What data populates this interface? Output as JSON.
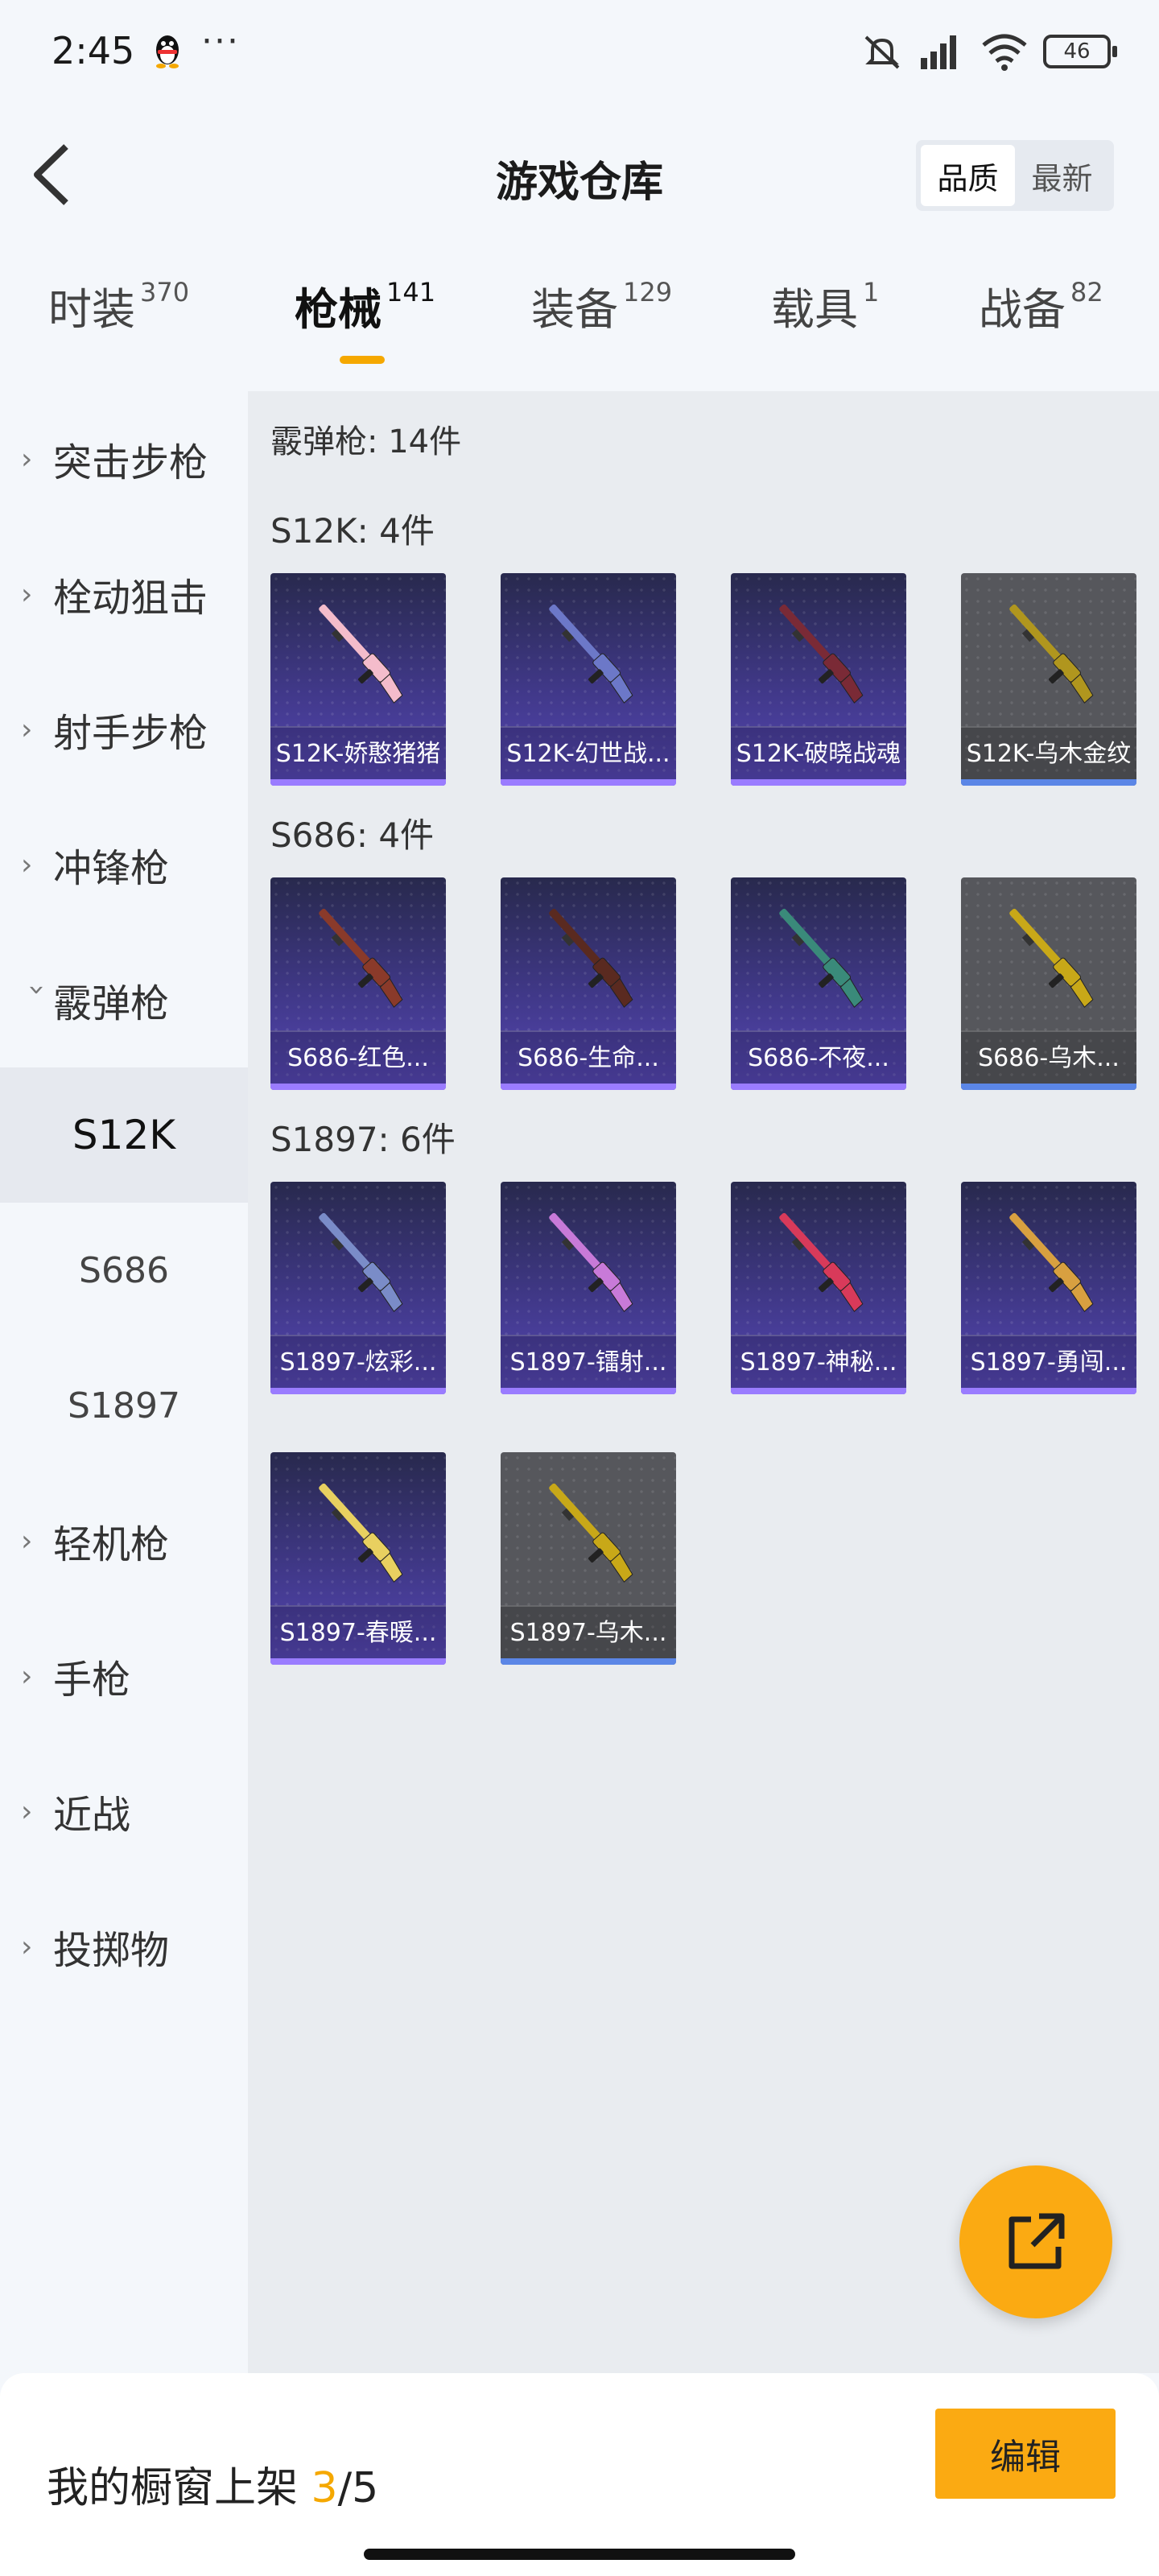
{
  "status_bar": {
    "time": "2:45",
    "dots": "···",
    "battery": "46"
  },
  "header": {
    "title": "游戏仓库",
    "sort": [
      "品质",
      "最新"
    ],
    "sort_active": "品质"
  },
  "category_tabs": [
    {
      "name": "时装",
      "count": "370"
    },
    {
      "name": "枪械",
      "count": "141",
      "active": true
    },
    {
      "name": "装备",
      "count": "129"
    },
    {
      "name": "载具",
      "count": "1"
    },
    {
      "name": "战备",
      "count": "82"
    }
  ],
  "sidebar": {
    "items": [
      "突击步枪",
      "栓动狙击",
      "射手步枪",
      "冲锋枪",
      "霰弹枪"
    ],
    "sub_items": [
      "S12K",
      "S686",
      "S1897"
    ],
    "active_sub": "S12K",
    "items_after": [
      "轻机枪",
      "手枪",
      "近战",
      "投掷物"
    ]
  },
  "main": {
    "total": "霰弹枪: 14件",
    "groups": [
      {
        "label": "S12K: 4件",
        "items": [
          {
            "name": "S12K-娇憨猪猪",
            "quality": "purple",
            "gun_color": "#f4bccb"
          },
          {
            "name": "S12K-幻世战...",
            "quality": "purple",
            "gun_color": "#6c78c8"
          },
          {
            "name": "S12K-破晓战魂",
            "quality": "purple",
            "gun_color": "#7a2a36"
          },
          {
            "name": "S12K-乌木金纹",
            "quality": "grey",
            "gun_color": "#b0961e"
          }
        ]
      },
      {
        "label": "S686: 4件",
        "items": [
          {
            "name": "S686-红色...",
            "quality": "purple",
            "gun_color": "#8a3a2a"
          },
          {
            "name": "S686-生命...",
            "quality": "purple",
            "gun_color": "#5a2a20"
          },
          {
            "name": "S686-不夜...",
            "quality": "purple",
            "gun_color": "#3a8a7a"
          },
          {
            "name": "S686-乌木...",
            "quality": "grey",
            "gun_color": "#c8a818"
          }
        ]
      },
      {
        "label": "S1897: 6件",
        "items": [
          {
            "name": "S1897-炫彩...",
            "quality": "purple",
            "gun_color": "#7a8cc8"
          },
          {
            "name": "S1897-镭射...",
            "quality": "purple",
            "gun_color": "#c87ad8"
          },
          {
            "name": "S1897-神秘...",
            "quality": "purple",
            "gun_color": "#d83a5a"
          },
          {
            "name": "S1897-勇闯...",
            "quality": "purple",
            "gun_color": "#d8a040"
          },
          {
            "name": "S1897-春暖...",
            "quality": "purple",
            "gun_color": "#e8d060"
          },
          {
            "name": "S1897-乌木...",
            "quality": "grey",
            "gun_color": "#c8a818"
          }
        ]
      }
    ]
  },
  "bottom": {
    "showcase_prefix": "我的橱窗上架 ",
    "current": "3",
    "max": "/5",
    "edit_label": "编辑"
  },
  "colors": {
    "accent": "#fbaa12",
    "purple_quality": "#9a7cff",
    "grey_quality": "#5b86e6"
  }
}
